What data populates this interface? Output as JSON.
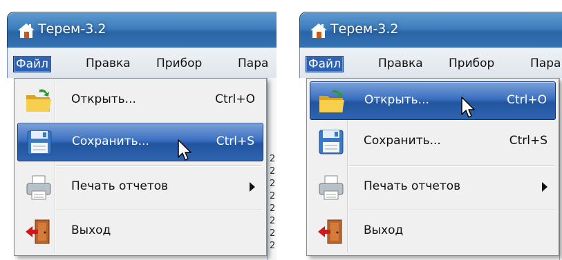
{
  "app": {
    "title": "Терем-3.2"
  },
  "menubar": {
    "items": [
      "Файл",
      "Правка",
      "Прибор",
      "Пара"
    ]
  },
  "file_menu": {
    "open": {
      "label": "Открыть...",
      "shortcut": "Ctrl+O"
    },
    "save": {
      "label": "Сохранить...",
      "shortcut": "Ctrl+S"
    },
    "print": {
      "label": "Печать отчетов"
    },
    "exit": {
      "label": "Выход"
    }
  },
  "background_digits": "2",
  "screenshots": [
    {
      "highlighted_item": "save"
    },
    {
      "highlighted_item": "open"
    }
  ],
  "colors": {
    "titlebar": "#3d7dbd",
    "menu_highlight": "#2d62b3",
    "exit_icon_door": "#b8642a",
    "exit_icon_arrow": "#d01818"
  }
}
